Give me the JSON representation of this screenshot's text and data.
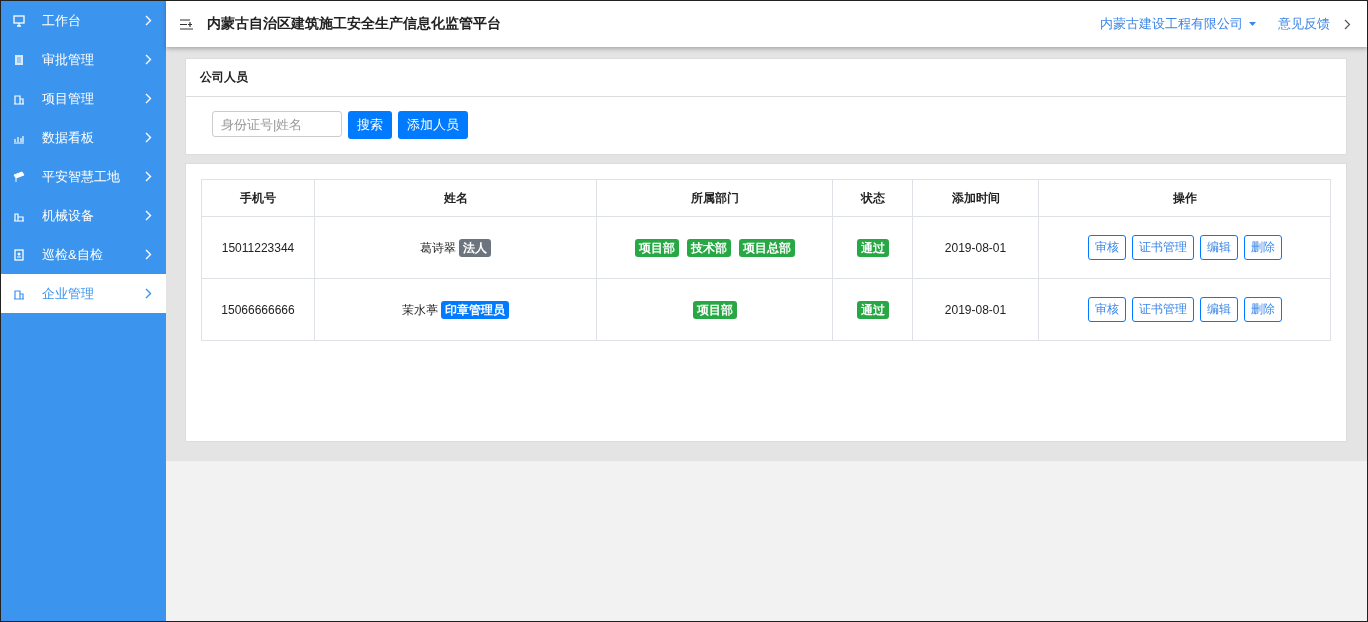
{
  "sidebar": {
    "items": [
      {
        "label": "工作台",
        "selected": false
      },
      {
        "label": "审批管理",
        "selected": false
      },
      {
        "label": "项目管理",
        "selected": false
      },
      {
        "label": "数据看板",
        "selected": false
      },
      {
        "label": "平安智慧工地",
        "selected": false
      },
      {
        "label": "机械设备",
        "selected": false
      },
      {
        "label": "巡检&自检",
        "selected": false
      },
      {
        "label": "企业管理",
        "selected": true
      }
    ]
  },
  "header": {
    "title": "内蒙古自治区建筑施工安全生产信息化监管平台",
    "company": "内蒙古建设工程有限公司",
    "feedback": "意见反馈"
  },
  "search_panel": {
    "title": "公司人员",
    "search": {
      "placeholder": "身份证号|姓名"
    },
    "buttons": [
      "搜索",
      "添加人员"
    ]
  },
  "table": {
    "columns": [
      "手机号",
      "姓名",
      "所属部门",
      "状态",
      "添加时间",
      "操作"
    ],
    "rows": [
      {
        "phone": "15011223344",
        "name": "葛诗翠",
        "role": {
          "label": "法人",
          "color": "#6c757d"
        },
        "departments": [
          "项目部",
          "技术部",
          "项目总部"
        ],
        "status": {
          "label": "通过",
          "color": "#28a745"
        },
        "added": "2019-08-01",
        "actions": [
          "审核",
          "证书管理",
          "编辑",
          "删除"
        ]
      },
      {
        "phone": "15066666666",
        "name": "茉水葶",
        "role": {
          "label": "印章管理员",
          "color": "#007bff"
        },
        "departments": [
          "项目部"
        ],
        "status": {
          "label": "通过",
          "color": "#28a745"
        },
        "added": "2019-08-01",
        "actions": [
          "审核",
          "证书管理",
          "编辑",
          "删除"
        ]
      }
    ]
  }
}
